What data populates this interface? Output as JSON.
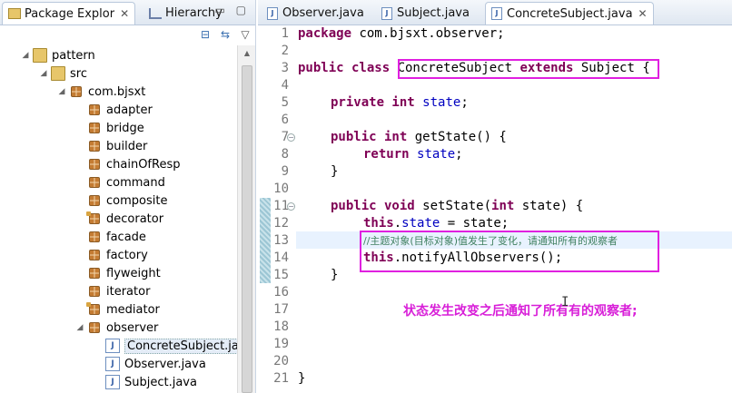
{
  "left_panel": {
    "tabs": [
      {
        "label": "Package Explor",
        "close": "✕"
      },
      {
        "label": "Hierarchy",
        "close": ""
      }
    ],
    "tree": [
      {
        "label": "pattern",
        "depth": 0,
        "icon": "project-icon",
        "twisty": "◢"
      },
      {
        "label": "src",
        "depth": 1,
        "icon": "source-folder-icon",
        "twisty": "◢"
      },
      {
        "label": "com.bjsxt",
        "depth": 2,
        "icon": "package-icon",
        "twisty": "◢"
      },
      {
        "label": "adapter",
        "depth": 3,
        "icon": "package-icon",
        "twisty": ""
      },
      {
        "label": "bridge",
        "depth": 3,
        "icon": "package-icon",
        "twisty": ""
      },
      {
        "label": "builder",
        "depth": 3,
        "icon": "package-icon",
        "twisty": ""
      },
      {
        "label": "chainOfResp",
        "depth": 3,
        "icon": "package-icon",
        "twisty": ""
      },
      {
        "label": "command",
        "depth": 3,
        "icon": "package-icon",
        "twisty": ""
      },
      {
        "label": "composite",
        "depth": 3,
        "icon": "package-icon",
        "twisty": ""
      },
      {
        "label": "decorator",
        "depth": 3,
        "icon": "package-icon-decorated",
        "twisty": ""
      },
      {
        "label": "facade",
        "depth": 3,
        "icon": "package-icon",
        "twisty": ""
      },
      {
        "label": "factory",
        "depth": 3,
        "icon": "package-icon",
        "twisty": ""
      },
      {
        "label": "flyweight",
        "depth": 3,
        "icon": "package-icon",
        "twisty": ""
      },
      {
        "label": "iterator",
        "depth": 3,
        "icon": "package-icon",
        "twisty": ""
      },
      {
        "label": "mediator",
        "depth": 3,
        "icon": "package-icon-decorated",
        "twisty": ""
      },
      {
        "label": "observer",
        "depth": 3,
        "icon": "package-icon",
        "twisty": "◢"
      },
      {
        "label": "ConcreteSubject.java",
        "depth": 4,
        "icon": "java-file-icon",
        "twisty": "",
        "selected": true
      },
      {
        "label": "Observer.java",
        "depth": 4,
        "icon": "java-file-icon",
        "twisty": ""
      },
      {
        "label": "Subject.java",
        "depth": 4,
        "icon": "java-file-icon",
        "twisty": ""
      }
    ]
  },
  "editor": {
    "tabs": [
      {
        "label": "Observer.java",
        "active": false
      },
      {
        "label": "Subject.java",
        "active": false
      },
      {
        "label": "ConcreteSubject.java",
        "active": true
      }
    ],
    "line_numbers": [
      "1",
      "2",
      "3",
      "4",
      "5",
      "6",
      "7",
      "8",
      "9",
      "10",
      "11",
      "12",
      "13",
      "14",
      "15",
      "16",
      "17",
      "18",
      "19",
      "20",
      "21"
    ],
    "code": {
      "l1_kw": "package",
      "l1_rest": " com.bjsxt.observer;",
      "l3_kw": "public class ",
      "l3_name": "ConcreteSubject ",
      "l3_kw2": "extends",
      "l3_super": " Subject",
      "l3_brace": " {",
      "l5_kw": "private int ",
      "l5_field": "state",
      "l5_end": ";",
      "l7_kw": "public int ",
      "l7_rest": "getState() {",
      "l8_kw": "return ",
      "l8_field": "state",
      "l8_end": ";",
      "l9": "}",
      "l11_kw": "public void ",
      "l11_rest": "setState(",
      "l11_kw2": "int ",
      "l11_rest2": "state) {",
      "l12_kw": "this",
      "l12_dot": ".",
      "l12_field": "state",
      "l12_rest": " = state;",
      "l13_comment": "//主题对象(目标对象)值发生了变化，请通知所有的观察者",
      "l14_kw": "this",
      "l14_rest": ".notifyAllObservers();",
      "l15": "}",
      "l21": "}"
    },
    "annotation": "状态发生改变之后通知了所有有的观察者;",
    "cursor_glyph": "I"
  },
  "colors": {
    "keyword": "#7f0055",
    "field": "#0000c0",
    "comment": "#3f7f5f",
    "highlight_box": "#e020e0",
    "annotation": "#d81fd8"
  }
}
